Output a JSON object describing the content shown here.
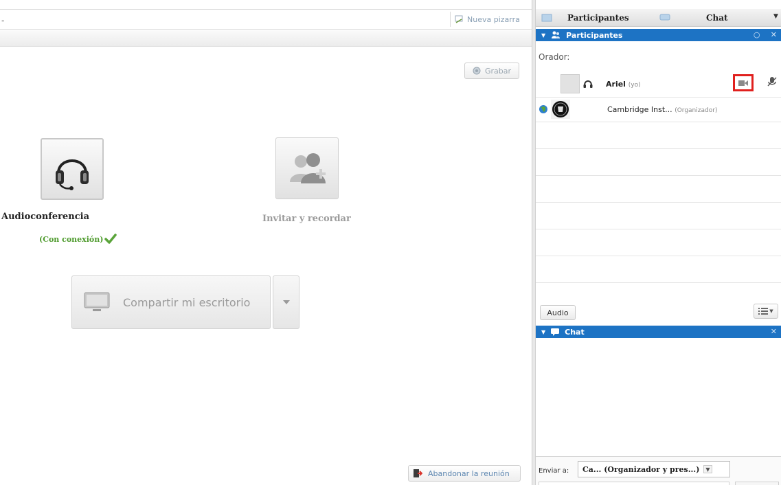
{
  "toolbar": {
    "new_board_label": "Nueva pizarra",
    "dash": "-"
  },
  "main": {
    "record_label": "Grabar",
    "audio": {
      "label": "Audioconferencia",
      "status": "(Con conexión)"
    },
    "invite": {
      "label": "Invitar y recordar"
    },
    "share_desktop_label": "Compartir mi escritorio",
    "leave_meeting_label": "Abandonar la reunión"
  },
  "panel": {
    "tabs": [
      {
        "label": "Participantes"
      },
      {
        "label": "Chat"
      }
    ],
    "participants_header": "Participantes",
    "speaker_label": "Orador:",
    "participants": [
      {
        "name": "Ariel",
        "tag": "(yo)"
      },
      {
        "name": "Cambridge Inst...",
        "tag": "(Organizador)"
      }
    ],
    "audio_button": "Audio",
    "chat_header": "Chat",
    "send_to_label": "Enviar a:",
    "send_to_value": "Ca... (Organizador y pres...)"
  },
  "colors": {
    "accent_blue": "#1d73c4",
    "highlight_red": "#e0201e",
    "connected_green": "#4f9b2e"
  }
}
